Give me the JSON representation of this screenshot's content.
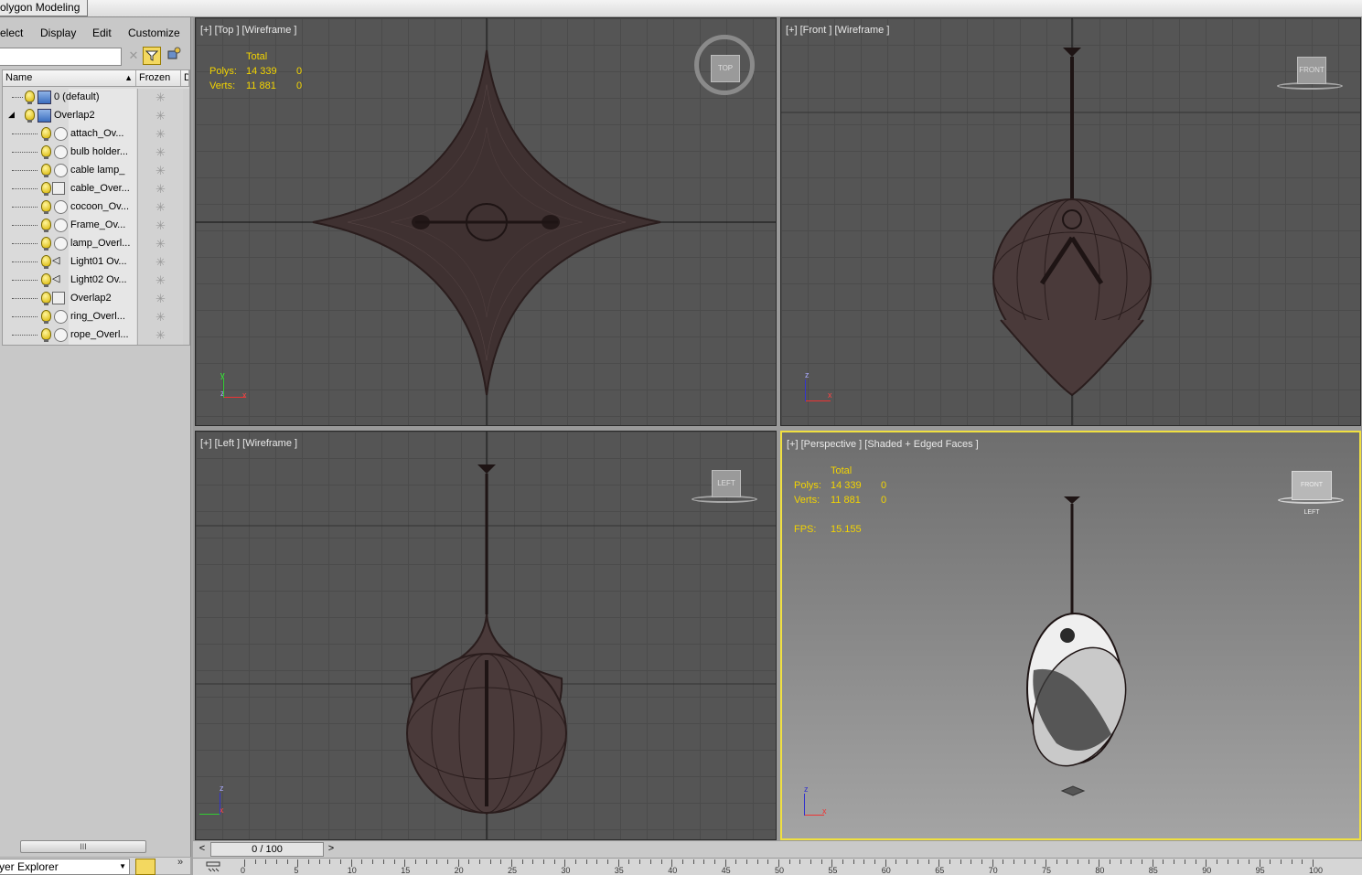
{
  "ribbon": {
    "tab_label": "olygon Modeling"
  },
  "menu": {
    "select": "elect",
    "display": "Display",
    "edit": "Edit",
    "customize": "Customize"
  },
  "scene_explorer": {
    "columns": {
      "name": "Name",
      "frozen": "Frozen",
      "d": "D"
    },
    "rows": [
      {
        "label": "0 (default)",
        "level": 0,
        "type": "layer"
      },
      {
        "label": "Overlap2",
        "level": 0,
        "type": "layer",
        "expanded": true
      },
      {
        "label": "attach_Ov...",
        "level": 1,
        "type": "geometry"
      },
      {
        "label": "bulb holder...",
        "level": 1,
        "type": "geometry"
      },
      {
        "label": "cable lamp_",
        "level": 1,
        "type": "geometry"
      },
      {
        "label": "cable_Over...",
        "level": 1,
        "type": "shape"
      },
      {
        "label": "cocoon_Ov...",
        "level": 1,
        "type": "geometry"
      },
      {
        "label": "Frame_Ov...",
        "level": 1,
        "type": "geometry"
      },
      {
        "label": "lamp_Overl...",
        "level": 1,
        "type": "geometry"
      },
      {
        "label": "Light01 Ov...",
        "level": 1,
        "type": "light"
      },
      {
        "label": "Light02 Ov...",
        "level": 1,
        "type": "light"
      },
      {
        "label": "Overlap2",
        "level": 1,
        "type": "group"
      },
      {
        "label": "ring_Overl...",
        "level": 1,
        "type": "geometry"
      },
      {
        "label": "rope_Overl...",
        "level": 1,
        "type": "geometry"
      }
    ],
    "frozen_glyph": "✳",
    "scroll_glyph": "III",
    "explorer_select": "yer Explorer"
  },
  "viewports": {
    "top": {
      "label": "[+] [Top ] [Wireframe ]",
      "cube": "TOP",
      "total": "Total",
      "polys_label": "Polys:",
      "polys": "14 339",
      "polys_sel": "0",
      "verts_label": "Verts:",
      "verts": "11 881",
      "verts_sel": "0",
      "axis1": "y",
      "axis2": "z",
      "axis3": "x"
    },
    "front": {
      "label": "[+] [Front ] [Wireframe ]",
      "cube": "FRONT",
      "axis1": "z",
      "axis2": "x"
    },
    "left": {
      "label": "[+] [Left ] [Wireframe ]",
      "cube": "LEFT",
      "axis1": "z",
      "axis2": "x"
    },
    "perspective": {
      "label": "[+] [Perspective ] [Shaded + Edged Faces ]",
      "cube": "FRONT LEFT",
      "total": "Total",
      "polys_label": "Polys:",
      "polys": "14 339",
      "polys_sel": "0",
      "verts_label": "Verts:",
      "verts": "11 881",
      "verts_sel": "0",
      "fps_label": "FPS:",
      "fps": "15.155",
      "axis1": "z",
      "axis2": "x"
    }
  },
  "timeline": {
    "position": "0 / 100",
    "prev": "<",
    "next": ">",
    "ticks": [
      "0",
      "5",
      "10",
      "15",
      "20",
      "25",
      "30",
      "35",
      "40",
      "45",
      "50",
      "55",
      "60",
      "65",
      "70",
      "75",
      "80",
      "85",
      "90",
      "95",
      "100"
    ]
  },
  "colors": {
    "accent_active": "#f0e040",
    "stats_text": "#f3d400",
    "wire": "#2a1d1d"
  }
}
